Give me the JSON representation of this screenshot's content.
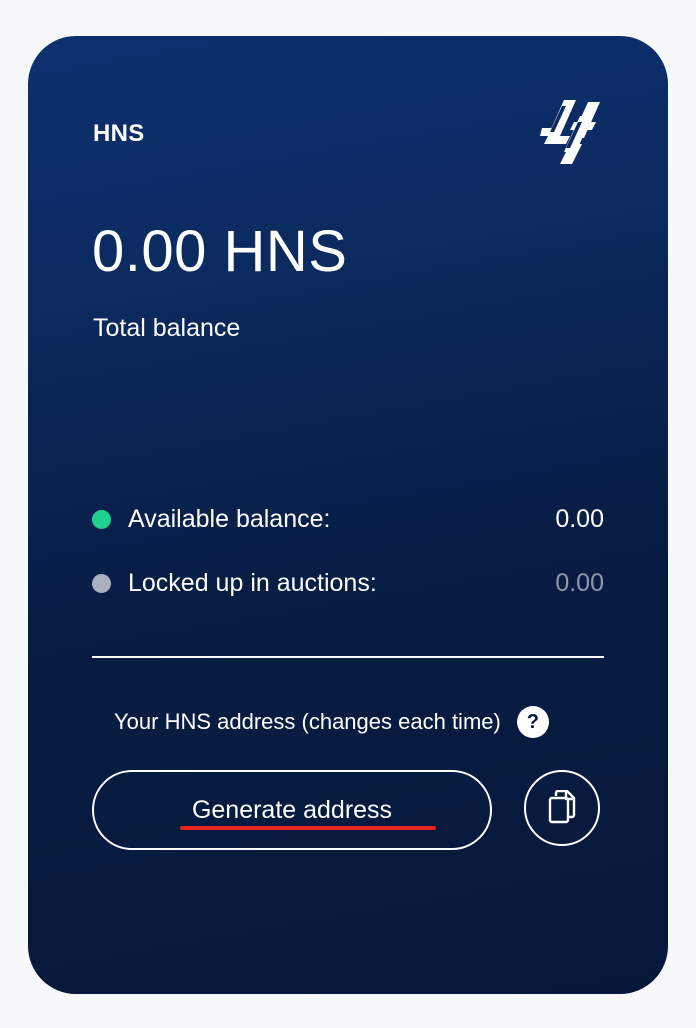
{
  "card": {
    "ticker": "HNS",
    "logo_icon": "handshake-logo-icon",
    "total_amount": "0.00 HNS",
    "total_label": "Total balance"
  },
  "balances": [
    {
      "label": "Available balance:",
      "value": "0.00",
      "dot_color": "#1fd18e",
      "value_color": "#ffffff"
    },
    {
      "label": "Locked up in auctions:",
      "value": "0.00",
      "dot_color": "#a9b0bf",
      "value_color": "#8e97ab"
    }
  ],
  "address": {
    "caption": "Your HNS address (changes each time)",
    "help_icon": "question-mark-icon",
    "help_glyph": "?",
    "generate_label": "Generate address",
    "copy_icon": "copy-icon"
  },
  "colors": {
    "card_top": "#0d3170",
    "card_bottom": "#06183a",
    "page_background": "#f7f8fa",
    "annotation_underline": "#e8231b"
  }
}
